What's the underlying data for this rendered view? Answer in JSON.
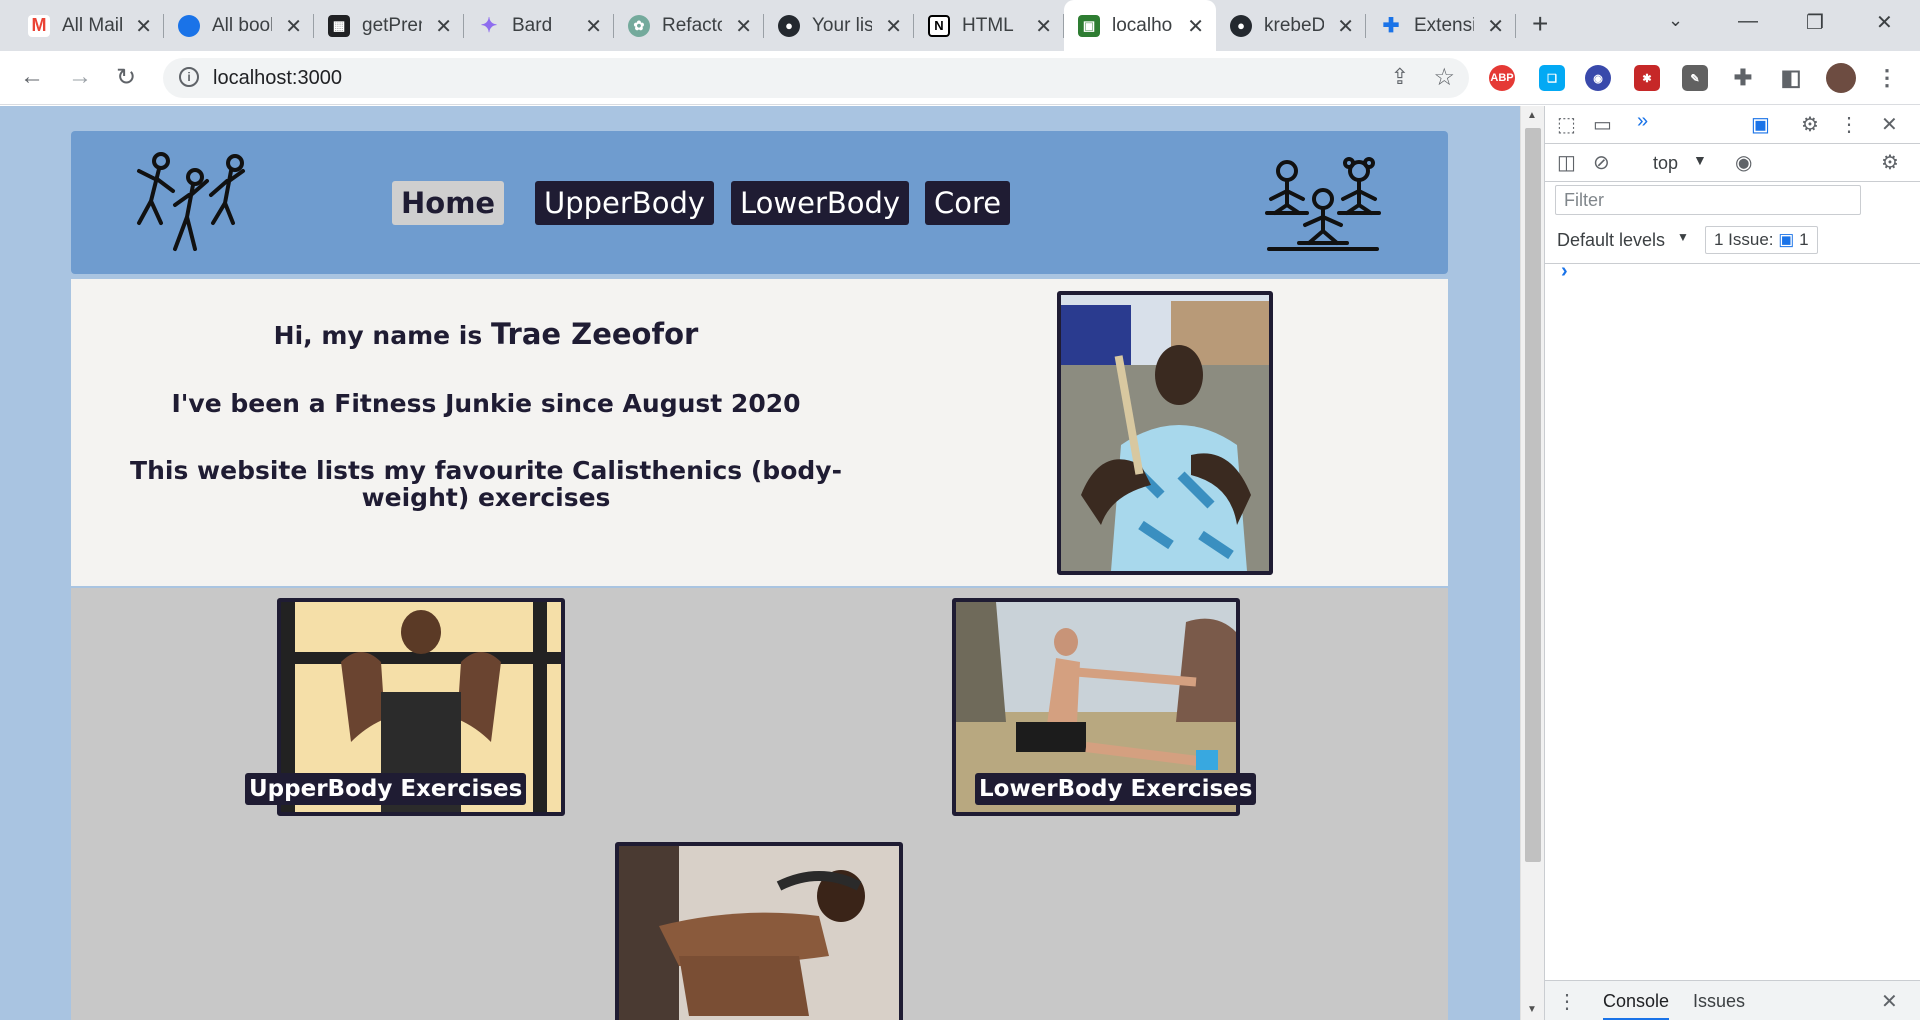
{
  "browser": {
    "tabs": [
      {
        "title": "All Mail",
        "favicon": "gmail-icon",
        "color": "#ea4335"
      },
      {
        "title": "All books",
        "favicon": "cloud-icon",
        "color": "#1a73e8"
      },
      {
        "title": "getPremium",
        "favicon": "grid-icon",
        "color": "#202124"
      },
      {
        "title": "Bard",
        "favicon": "bard-icon",
        "color": "#8e6cef"
      },
      {
        "title": "Refactor",
        "favicon": "openai-icon",
        "color": "#74aa9c"
      },
      {
        "title": "Your list",
        "favicon": "github-icon",
        "color": "#24292f"
      },
      {
        "title": "HTML",
        "favicon": "notion-icon",
        "color": "#000000"
      },
      {
        "title": "localhost",
        "favicon": "localhost-icon",
        "color": "#2e7d32",
        "active": true
      },
      {
        "title": "krebeD",
        "favicon": "github-icon",
        "color": "#24292f"
      },
      {
        "title": "Extensions",
        "favicon": "puzzle-icon",
        "color": "#1a73e8"
      }
    ],
    "url": "localhost:3000"
  },
  "site": {
    "nav": [
      "Home",
      "UpperBody",
      "LowerBody",
      "Core"
    ],
    "intro": {
      "line1_prefix": "Hi, my name is ",
      "line1_name": "Trae Zeeofor",
      "line2": "I've been a Fitness Junkie since August 2020",
      "line3": "This website lists my favourite Calisthenics (body-weight) exercises"
    },
    "cards": [
      {
        "caption": "UpperBody Exercises"
      },
      {
        "caption": "LowerBody Exercises"
      }
    ],
    "colors": {
      "header": "#6f9ccf",
      "dark": "#1f1c33",
      "intro_bg": "#f4f3f1",
      "gallery_bg": "#c8c8c8",
      "page_bg": "#a9c4e1"
    }
  },
  "devtools": {
    "context": "top",
    "filter_placeholder": "Filter",
    "levels": "Default levels",
    "issues_label": "1 Issue:",
    "issues_count": "1",
    "drawer_tabs": [
      "Console",
      "Issues"
    ]
  }
}
